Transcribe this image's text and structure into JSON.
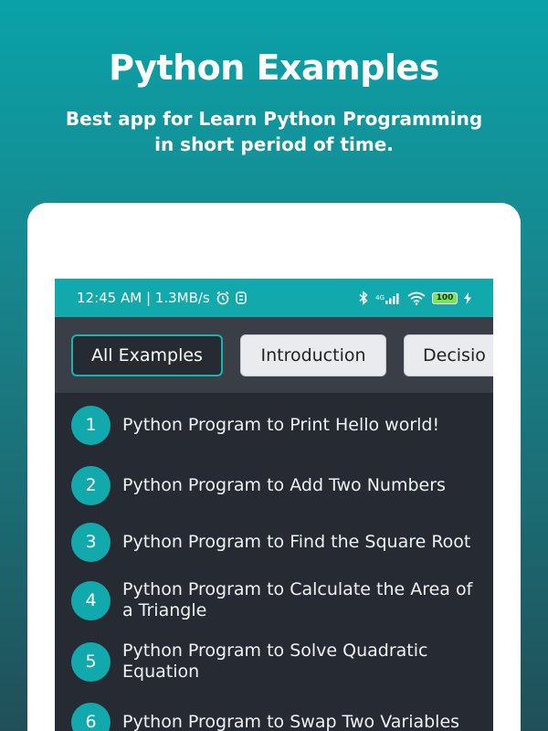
{
  "promo": {
    "title": "Python Examples",
    "subtitle": "Best app for Learn Python Programming in short period of time."
  },
  "status_bar": {
    "time_speed": "12:45 AM | 1.3MB/s",
    "network_type": "4G",
    "battery": "100",
    "icons": [
      "alarm-icon",
      "app-notification-icon",
      "bluetooth-icon",
      "signal-icon",
      "wifi-icon",
      "battery-icon",
      "charging-icon"
    ]
  },
  "tabs": [
    {
      "label": "All Examples",
      "selected": true
    },
    {
      "label": "Introduction",
      "selected": false
    },
    {
      "label": "Decisio",
      "selected": false
    }
  ],
  "examples": [
    {
      "number": "1",
      "title": "Python Program to Print Hello world!"
    },
    {
      "number": "2",
      "title": "Python Program to Add Two Numbers"
    },
    {
      "number": "3",
      "title": "Python Program to Find the Square Root"
    },
    {
      "number": "4",
      "title": "Python Program to Calculate the Area of a Triangle"
    },
    {
      "number": "5",
      "title": "Python Program to Solve Quadratic Equation"
    },
    {
      "number": "6",
      "title": "Python Program to Swap Two Variables"
    }
  ],
  "colors": {
    "accent": "#12a9ad",
    "status_bar": "#11a9ab",
    "tab_bar": "#3a3e46",
    "list_background": "#262b33"
  }
}
